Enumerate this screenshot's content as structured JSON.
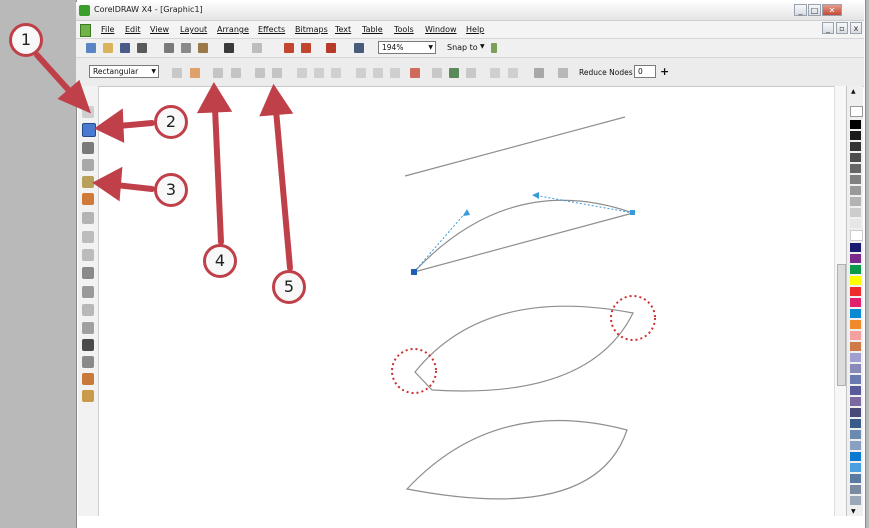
{
  "window": {
    "title": "CorelDRAW X4 - [Graphic1]"
  },
  "window_controls": [
    "_",
    "□",
    "✕"
  ],
  "doc_controls": [
    "_",
    "▫",
    "x"
  ],
  "menu": [
    "File",
    "Edit",
    "View",
    "Layout",
    "Arrange",
    "Effects",
    "Bitmaps",
    "Text",
    "Table",
    "Tools",
    "Window",
    "Help"
  ],
  "standard_toolbar": {
    "zoom": "194%",
    "snap_to": "Snap to"
  },
  "property_bar": {
    "selection_mode": "Rectangular",
    "reduce_nodes_label": "Reduce Nodes",
    "reduce_nodes_value": "0",
    "plus": "+"
  },
  "annotations": [
    "1",
    "2",
    "3",
    "4",
    "5"
  ],
  "colors": {
    "arrow": "#c0404a",
    "curve": "#8f8f8f",
    "handle": "#3a9ad9",
    "node": "#1e5fb5"
  }
}
